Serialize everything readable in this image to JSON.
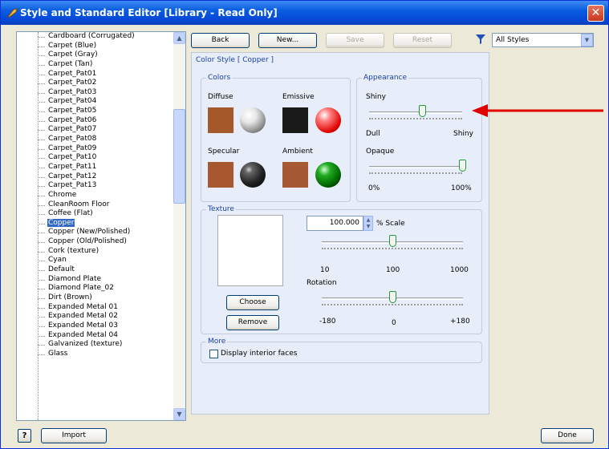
{
  "window": {
    "title": "Style and Standard Editor [Library - Read Only]",
    "close_glyph": "✕"
  },
  "style_list": {
    "items": [
      "Cardboard (Corrugated)",
      "Carpet (Blue)",
      "Carpet (Gray)",
      "Carpet (Tan)",
      "Carpet_Pat01",
      "Carpet_Pat02",
      "Carpet_Pat03",
      "Carpet_Pat04",
      "Carpet_Pat05",
      "Carpet_Pat06",
      "Carpet_Pat07",
      "Carpet_Pat08",
      "Carpet_Pat09",
      "Carpet_Pat10",
      "Carpet_Pat11",
      "Carpet_Pat12",
      "Carpet_Pat13",
      "Chrome",
      "CleanRoom Floor",
      "Coffee (Flat)",
      "Copper",
      "Copper (New/Polished)",
      "Copper (Old/Polished)",
      "Cork (texture)",
      "Cyan",
      "Default",
      "Diamond Plate",
      "Diamond Plate_02",
      "Dirt (Brown)",
      "Expanded Metal 01",
      "Expanded Metal 02",
      "Expanded Metal 03",
      "Expanded Metal 04",
      "Galvanized (texture)",
      "Glass"
    ],
    "selected": "Copper"
  },
  "toolbar": {
    "back": "Back",
    "new": "New...",
    "save": "Save",
    "reset": "Reset",
    "filter": "All Styles"
  },
  "breadcrumb": "Color Style [ Copper ]",
  "colors": {
    "label": "Colors",
    "diffuse": "Diffuse",
    "emissive": "Emissive",
    "specular": "Specular",
    "ambient": "Ambient",
    "diffuse_color": "#a5592a",
    "emissive_color": "#1a1a1a",
    "specular_color": "#a8582e",
    "ambient_color": "#a55a34"
  },
  "appearance": {
    "label": "Appearance",
    "shiny": "Shiny",
    "dull": "Dull",
    "shiny_max": "Shiny",
    "shiny_level": 0.57,
    "opaque": "Opaque",
    "min": "0%",
    "max": "100%",
    "opaque_level": 1.0
  },
  "texture": {
    "label": "Texture",
    "scale_value": "100.000",
    "scale_label": "% Scale",
    "scale_min": "10",
    "scale_mid": "100",
    "scale_max": "1000",
    "scale_level": 0.5,
    "rotation": "Rotation",
    "rot_min": "-180",
    "rot_mid": "0",
    "rot_max": "+180",
    "rotation_level": 0.5,
    "choose": "Choose",
    "remove": "Remove"
  },
  "more": {
    "label": "More",
    "display_interior": "Display interior faces"
  },
  "footer": {
    "help": "?",
    "import": "Import",
    "done": "Done"
  },
  "annotation_color": "#e00000"
}
